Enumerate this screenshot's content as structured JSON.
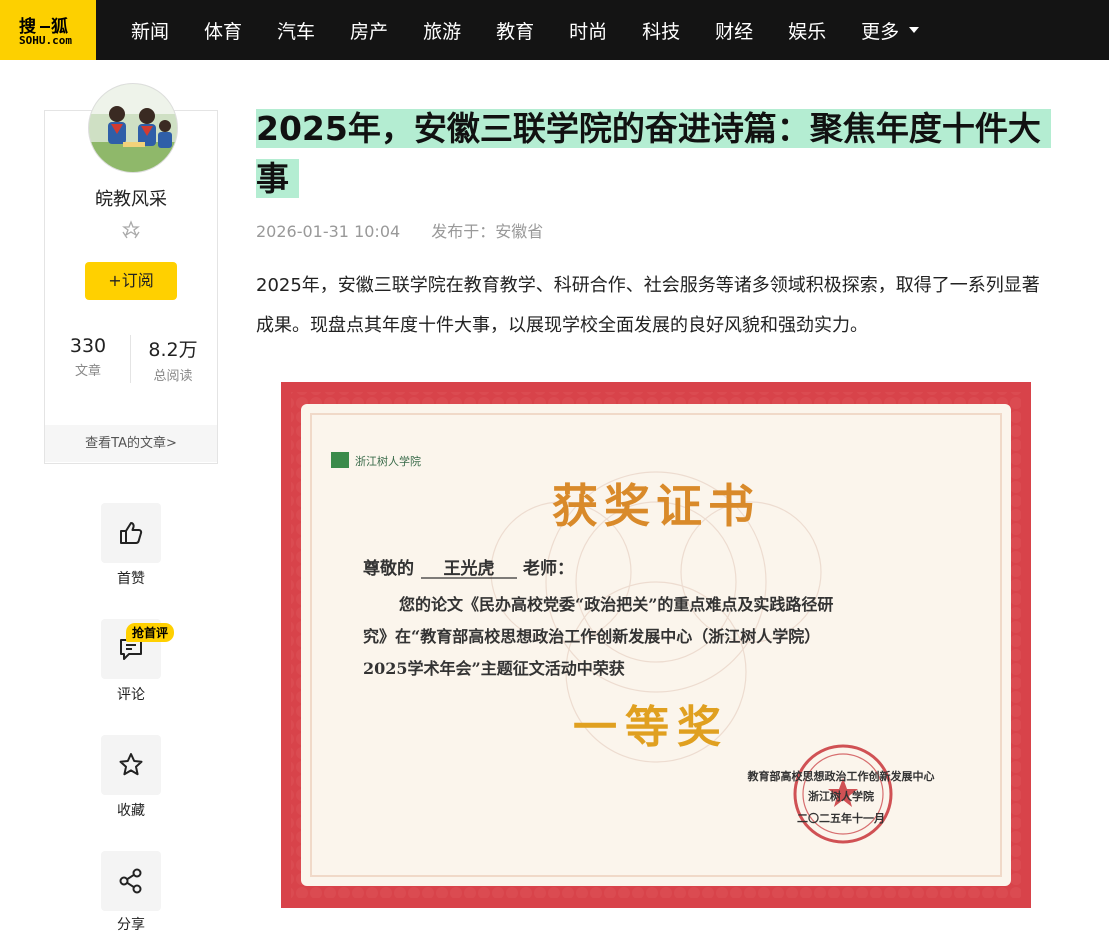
{
  "logo": {
    "top": "搜狐",
    "bottom": "SOHU.com",
    "color": "#fdd000"
  },
  "nav": {
    "items": [
      "新闻",
      "体育",
      "汽车",
      "房产",
      "旅游",
      "教育",
      "时尚",
      "科技",
      "财经",
      "娱乐"
    ],
    "more_label": "更多"
  },
  "author": {
    "name": "皖教风采",
    "subscribe_label": "+订阅",
    "stats": [
      {
        "value": "330",
        "label": "文章"
      },
      {
        "value": "8.2万",
        "label": "总阅读"
      }
    ],
    "view_articles_label": "查看TA的文章>"
  },
  "actions": [
    {
      "label": "首赞",
      "icon": "thumbs-up-icon"
    },
    {
      "label": "评论",
      "icon": "comment-icon",
      "tag": "抢首评"
    },
    {
      "label": "收藏",
      "icon": "star-icon"
    },
    {
      "label": "分享",
      "icon": "share-icon"
    }
  ],
  "article": {
    "title": "2025年，安徽三联学院的奋进诗篇：聚焦年度十件大事",
    "date": "2026-01-31 10:04",
    "published_from": "发布于：安徽省",
    "intro": "2025年，安徽三联学院在教育教学、科研合作、社会服务等诸多领域积极探索，取得了一系列显著成果。现盘点其年度十件大事，以展现学校全面发展的良好风貌和强劲实力。"
  },
  "certificate": {
    "school_logo_text": "浙江树人学院",
    "heading": "获奖证书",
    "salutation_pre": "尊敬的",
    "recipient": "王光虎",
    "salutation_post": "老师：",
    "body_line1": "您的论文《民办高校党委“政治把关”的重点难点及实践路径研",
    "body_line2": "究》在“教育部高校思想政治工作创新发展中心（浙江树人学院）",
    "body_line3": "2025学术年会”主题征文活动中荣获",
    "award": "一等奖",
    "issuer_line1": "教育部高校思想政治工作创新发展中心",
    "issuer_line2": "浙江树人学院",
    "issuer_date": "二〇二五年十一月"
  }
}
